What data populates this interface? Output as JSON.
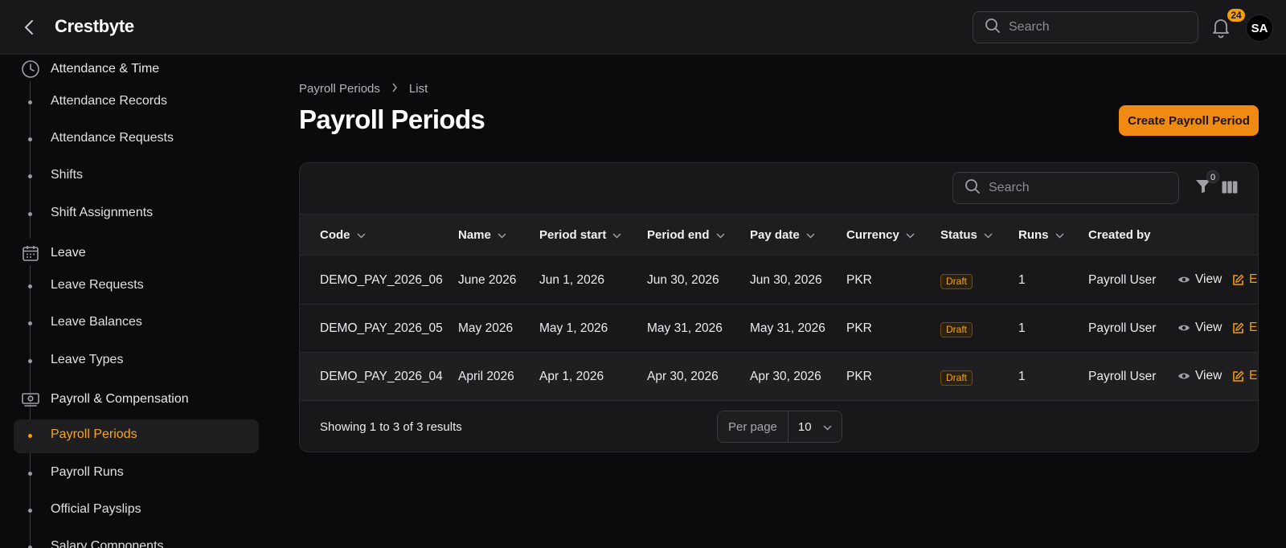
{
  "app": {
    "brand": "Crestbyte"
  },
  "topbar": {
    "search_placeholder": "Search",
    "notification_count": "24",
    "avatar_initials": "SA"
  },
  "sidebar": {
    "attendance": {
      "label": "Attendance & Time",
      "items": [
        "Attendance Records",
        "Attendance Requests",
        "Shifts",
        "Shift Assignments"
      ]
    },
    "leave": {
      "label": "Leave",
      "items": [
        "Leave Requests",
        "Leave Balances",
        "Leave Types"
      ]
    },
    "payroll": {
      "label": "Payroll & Compensation",
      "items": [
        "Payroll Periods",
        "Payroll Runs",
        "Official Payslips",
        "Salary Components"
      ],
      "active": "Payroll Periods"
    }
  },
  "breadcrumb": {
    "parent": "Payroll Periods",
    "current": "List"
  },
  "page": {
    "title": "Payroll Periods",
    "create_label": "Create Payroll Period"
  },
  "table": {
    "search_placeholder": "Search",
    "filter_count": "0",
    "columns": [
      "Code",
      "Name",
      "Period start",
      "Period end",
      "Pay date",
      "Currency",
      "Status",
      "Runs",
      "Created by"
    ],
    "rows": [
      {
        "code": "DEMO_PAY_2026_06",
        "name": "June 2026",
        "start": "Jun 1, 2026",
        "end": "Jun 30, 2026",
        "pay": "Jun 30, 2026",
        "currency": "PKR",
        "status": "Draft",
        "runs": "1",
        "created_by": "Payroll User"
      },
      {
        "code": "DEMO_PAY_2026_05",
        "name": "May 2026",
        "start": "May 1, 2026",
        "end": "May 31, 2026",
        "pay": "May 31, 2026",
        "currency": "PKR",
        "status": "Draft",
        "runs": "1",
        "created_by": "Payroll User"
      },
      {
        "code": "DEMO_PAY_2026_04",
        "name": "April 2026",
        "start": "Apr 1, 2026",
        "end": "Apr 30, 2026",
        "pay": "Apr 30, 2026",
        "currency": "PKR",
        "status": "Draft",
        "runs": "1",
        "created_by": "Payroll User"
      }
    ],
    "actions": {
      "view": "View",
      "edit": "Ed"
    },
    "footer": {
      "summary": "Showing 1 to 3 of 3 results",
      "per_page_label": "Per page",
      "per_page_value": "10"
    }
  },
  "colors": {
    "accent": "#f08a12",
    "active_text": "#f5a524",
    "background": "#0b0b0d",
    "panel": "#18181b"
  }
}
